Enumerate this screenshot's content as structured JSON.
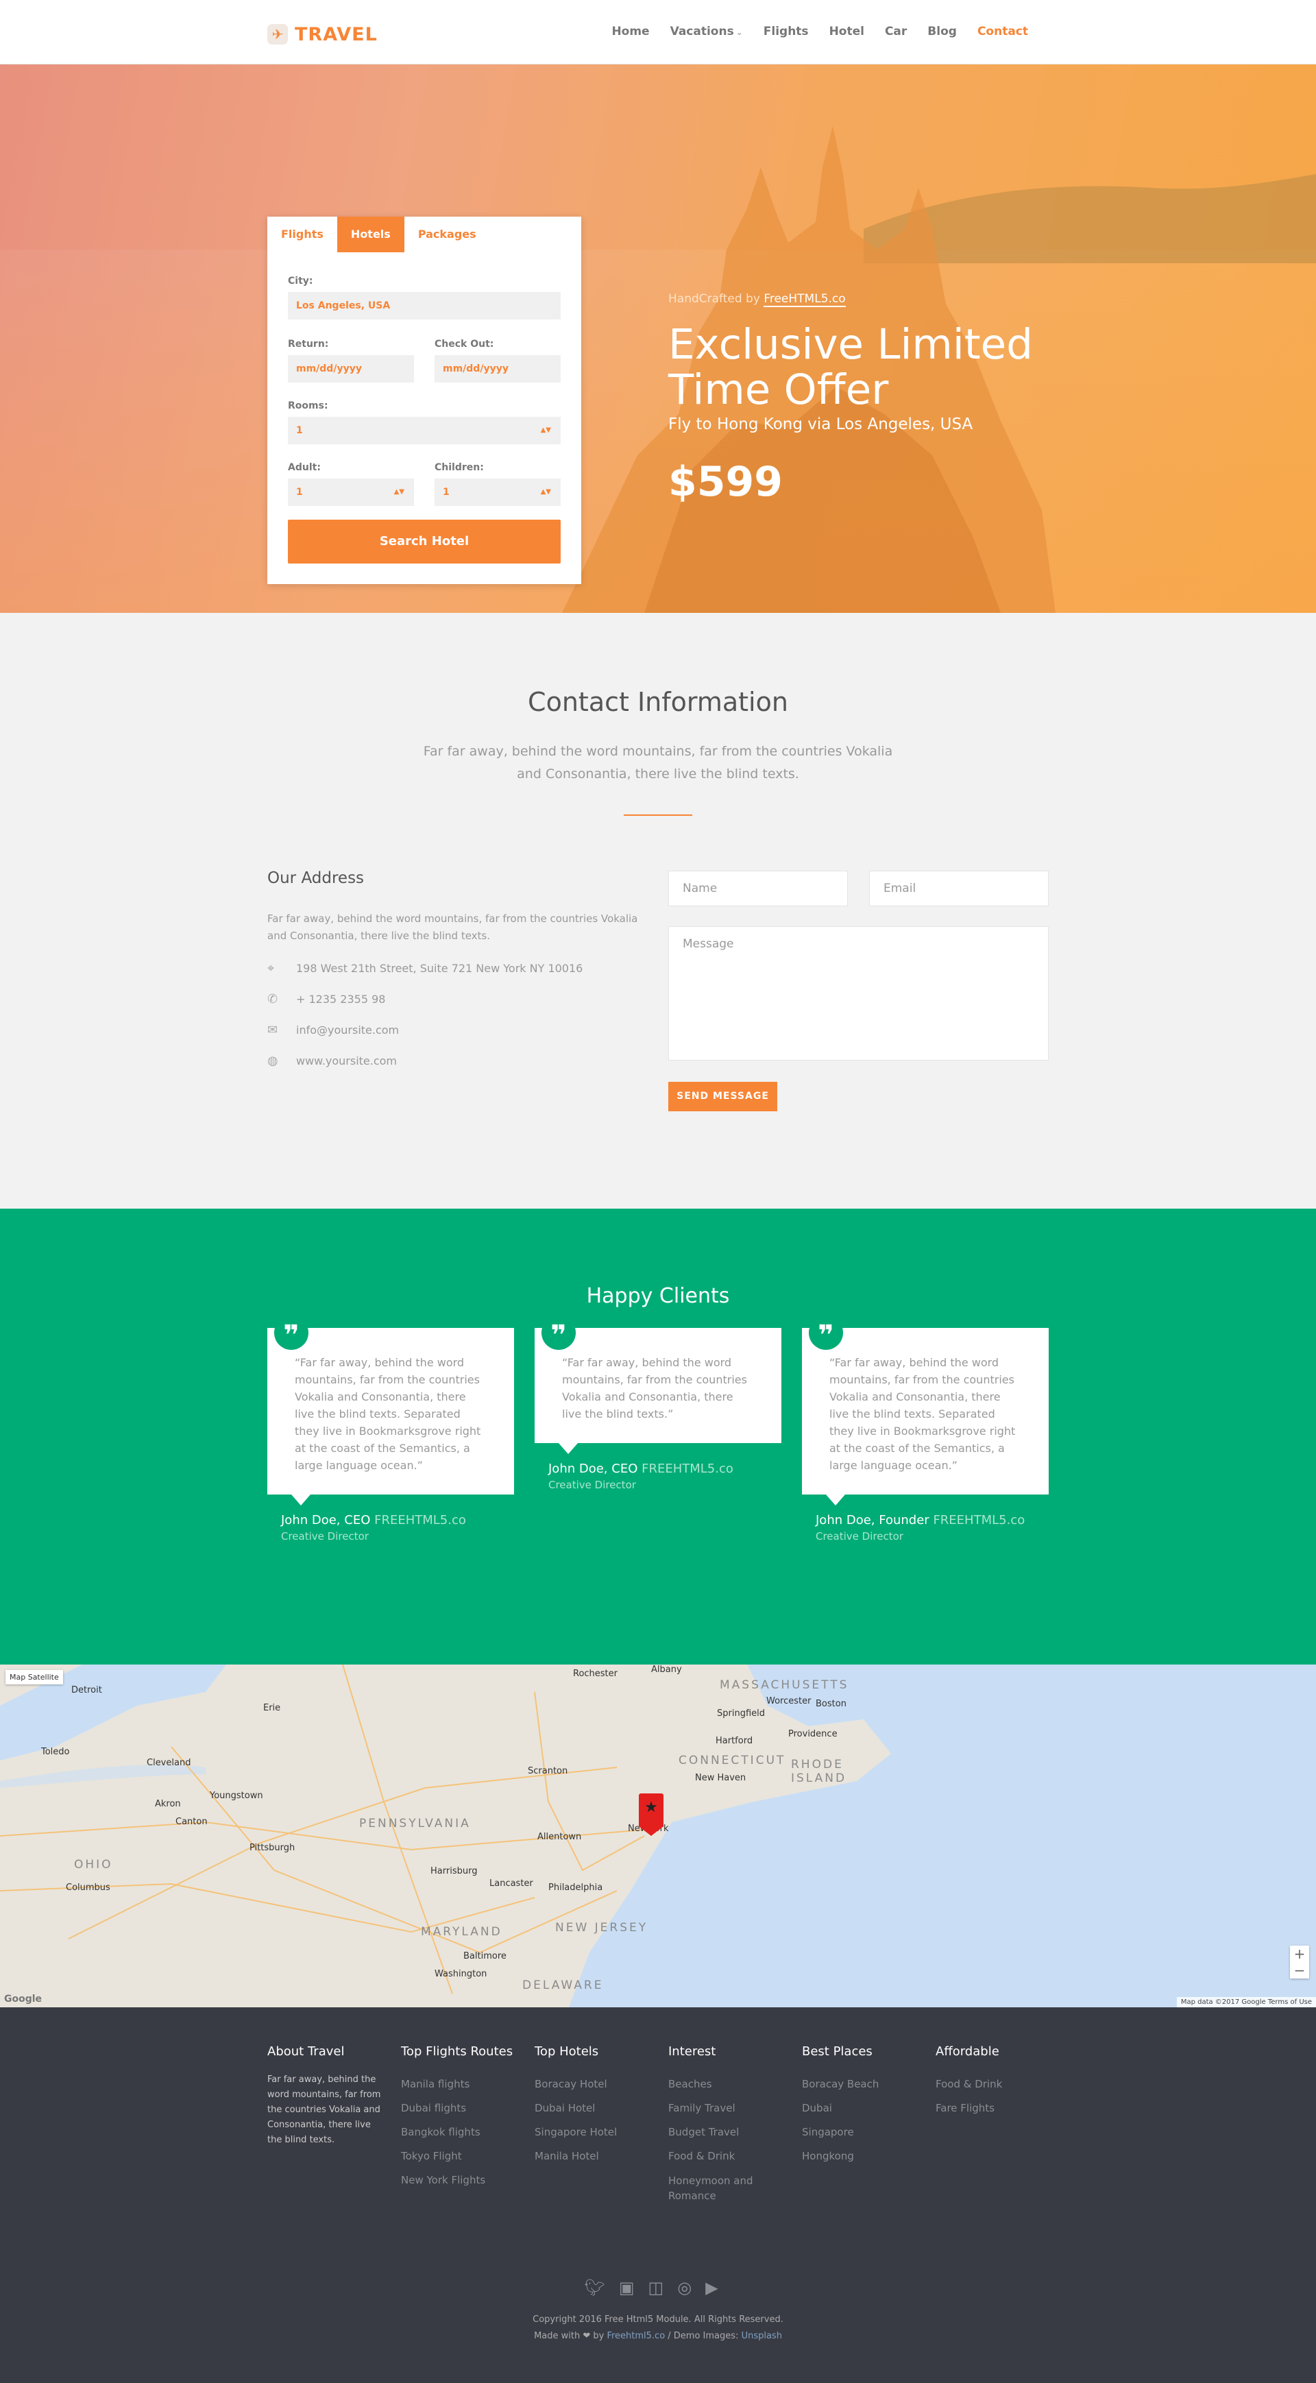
{
  "header": {
    "logo": "TRAVEL",
    "nav": [
      {
        "label": "Home"
      },
      {
        "label": "Vacations"
      },
      {
        "label": "Flights"
      },
      {
        "label": "Hotel"
      },
      {
        "label": "Car"
      },
      {
        "label": "Blog"
      },
      {
        "label": "Contact"
      }
    ],
    "active": "Contact",
    "accent": "#f78536"
  },
  "booking": {
    "tabs": [
      "Flights",
      "Hotels",
      "Packages"
    ],
    "active_tab": "Hotels",
    "city_label": "City:",
    "city_value": "Los Angeles, USA",
    "return_label": "Return:",
    "return_placeholder": "mm/dd/yyyy",
    "checkout_label": "Check Out:",
    "checkout_placeholder": "mm/dd/yyyy",
    "rooms_label": "Rooms:",
    "rooms_value": "1",
    "adult_label": "Adult:",
    "adult_value": "1",
    "children_label": "Children:",
    "children_value": "1",
    "search_button": "Search Hotel"
  },
  "offer": {
    "handcrafted_prefix": "HandCrafted by ",
    "handcrafted_link": "FreeHTML5.co",
    "title": "Exclusive Limited Time Offer",
    "subtitle": "Fly to Hong Kong via Los Angeles, USA",
    "price": "$599"
  },
  "contact": {
    "title": "Contact Information",
    "description": "Far far away, behind the word mountains, far from the countries Vokalia and Consonantia, there live the blind texts.",
    "address_title": "Our Address",
    "address_desc": "Far far away, behind the word mountains, far from the countries Vokalia and Consonantia, there live the blind texts.",
    "address": "198 West 21th Street, Suite 721 New York NY 10016",
    "phone": "+ 1235 2355 98",
    "email": "info@yoursite.com",
    "website": "www.yoursite.com",
    "name_placeholder": "Name",
    "email_placeholder": "Email",
    "message_placeholder": "Message",
    "send_button": "SEND MESSAGE"
  },
  "testimonials": {
    "title": "Happy Clients",
    "bg": "#00ac76",
    "items": [
      {
        "quote": "“Far far away, behind the word mountains, far from the countries Vokalia and Consonantia, there live the blind texts. Separated they live in Bookmarksgrove right at the coast of the Semantics, a large language ocean.”",
        "name": "John Doe, CEO",
        "company": "FREEHTML5.co",
        "role": "Creative Director"
      },
      {
        "quote": "“Far far away, behind the word mountains, far from the countries Vokalia and Consonantia, there live the blind texts.”",
        "name": "John Doe, CEO",
        "company": "FREEHTML5.co",
        "role": "Creative Director"
      },
      {
        "quote": "“Far far away, behind the word mountains, far from the countries Vokalia and Consonantia, there live the blind texts. Separated they live in Bookmarksgrove right at the coast of the Semantics, a large language ocean.”",
        "name": "John Doe, Founder",
        "company": "FREEHTML5.co",
        "role": "Creative Director"
      }
    ]
  },
  "map": {
    "controls": "Map  Satellite",
    "attribution": "Map data ©2017 Google   Terms of Use",
    "google": "Google",
    "labels": [
      "Detroit",
      "Cleveland",
      "Pittsburgh",
      "Columbus",
      "Philadelphia",
      "New York",
      "Baltimore",
      "Washington",
      "Boston",
      "Hartford",
      "Providence",
      "Albany",
      "Springfield",
      "Erie",
      "Toledo",
      "Akron",
      "Harrisburg",
      "Allentown",
      "Scranton",
      "New Haven",
      "Worcester",
      "Lancaster",
      "Youngstown",
      "Canton",
      "Rochester"
    ],
    "states": [
      "PENNSYLVANIA",
      "OHIO",
      "NEW JERSEY",
      "MARYLAND",
      "DELAWARE",
      "CONNECTICUT",
      "RHODE ISLAND",
      "MASSACHUSETTS"
    ]
  },
  "footer": {
    "about_title": "About Travel",
    "about_text": "Far far away, behind the word mountains, far from the countries Vokalia and Consonantia, there live the blind texts.",
    "routes_title": "Top Flights Routes",
    "routes": [
      "Manila flights",
      "Dubai flights",
      "Bangkok flights",
      "Tokyo Flight",
      "New York Flights"
    ],
    "hotels_title": "Top Hotels",
    "hotels": [
      "Boracay Hotel",
      "Dubai Hotel",
      "Singapore Hotel",
      "Manila Hotel"
    ],
    "interest_title": "Interest",
    "interest": [
      "Beaches",
      "Family Travel",
      "Budget Travel",
      "Food & Drink",
      "Honeymoon and Romance"
    ],
    "places_title": "Best Places",
    "places": [
      "Boracay Beach",
      "Dubai",
      "Singapore",
      "Hongkong"
    ],
    "affordable_title": "Affordable",
    "affordable": [
      "Food & Drink",
      "Fare Flights"
    ],
    "copy1": "Copyright 2016 Free Html5 Module. All Rights Reserved.",
    "copy2_prefix": "Made with ❤ by ",
    "copy2_link1": "Freehtml5.co",
    "copy2_mid": " / Demo Images: ",
    "copy2_link2": "Unsplash"
  }
}
